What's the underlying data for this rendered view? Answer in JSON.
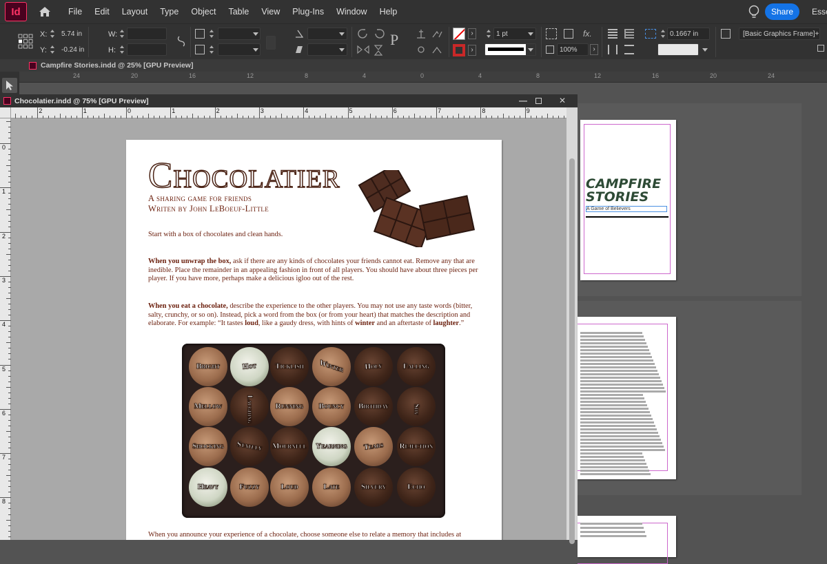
{
  "app": {
    "logo": "Id",
    "menu": [
      "File",
      "Edit",
      "Layout",
      "Type",
      "Object",
      "Table",
      "View",
      "Plug-Ins",
      "Window",
      "Help"
    ],
    "share_label": "Share",
    "workspace_label": "Esse"
  },
  "control_panel": {
    "x_label": "X:",
    "x_value": "5.74 in",
    "y_label": "Y:",
    "y_value": "-0.24 in",
    "w_label": "W:",
    "h_label": "H:",
    "stroke_weight": "1 pt",
    "zoom": "100%",
    "offset_value": "0.1667 in",
    "object_style": "[Basic Graphics Frame]+",
    "fx_label": "fx."
  },
  "background_doc": {
    "title": "Campfire Stories.indd @ 25% [GPU Preview]",
    "ruler_numbers": [
      "24",
      "20",
      "16",
      "12",
      "8",
      "4",
      "0",
      "4",
      "8",
      "12",
      "16",
      "20",
      "24"
    ]
  },
  "front_doc": {
    "title": "Chocolatier.indd @ 75% [GPU Preview]",
    "h_ruler_numbers": [
      "2",
      "1",
      "0",
      "1",
      "2",
      "3",
      "4",
      "5",
      "6",
      "7",
      "8",
      "9"
    ],
    "v_ruler_numbers": [
      "0",
      "1",
      "2",
      "3",
      "4",
      "5",
      "6",
      "7",
      "8"
    ]
  },
  "page": {
    "title": "Chocolatier",
    "subtitle1": "A sharing game for friends",
    "subtitle2": "Writen by John LeBoeuf-Little",
    "para0": "Start with a box of chocolates and clean hands.",
    "para1_lead": "When you unwrap the box,",
    "para1_rest": " ask if there are any kinds of chocolates your friends cannot eat. Remove any that are inedible. Place the remainder in an appealing fashion in front of all players. You should have about three pieces per player. If you have more, perhaps make a delicious igloo out of the rest.",
    "para2_lead": "When you eat a chocolate,",
    "para2_mid": " describe the experience to the other players. You may not use any taste words (bitter, salty, crunchy, or so on). Instead, pick a word from the box (or from your heart) that matches the description and elaborate. For example: “It tastes ",
    "para2_loud": "loud",
    "para2_mid2": ", like a gaudy dress, with hints of ",
    "para2_winter": "winter",
    "para2_mid3": " and an aftertaste of ",
    "para2_laughter": "laughter",
    "para2_end": ".”",
    "para3": "When you announce your experience of a chocolate, choose someone else to relate a memory that includes at",
    "chocolate_words": [
      "Bright",
      "Hot",
      "Ticklish",
      "Winter",
      "Holy",
      "Falling",
      "Mellow",
      "Laughing",
      "Running",
      "Bouncy",
      "Birthday",
      "Shy",
      "Shocking",
      "Stately",
      "Mournful",
      "Yearning",
      "Tears",
      "Rejection",
      "Heavy",
      "Fuzzy",
      "Loud",
      "Late",
      "Silvery",
      "Echo"
    ]
  },
  "right_pages": {
    "title": "CAMPFIRE STORIES",
    "subtitle": "A Game of Believers"
  }
}
